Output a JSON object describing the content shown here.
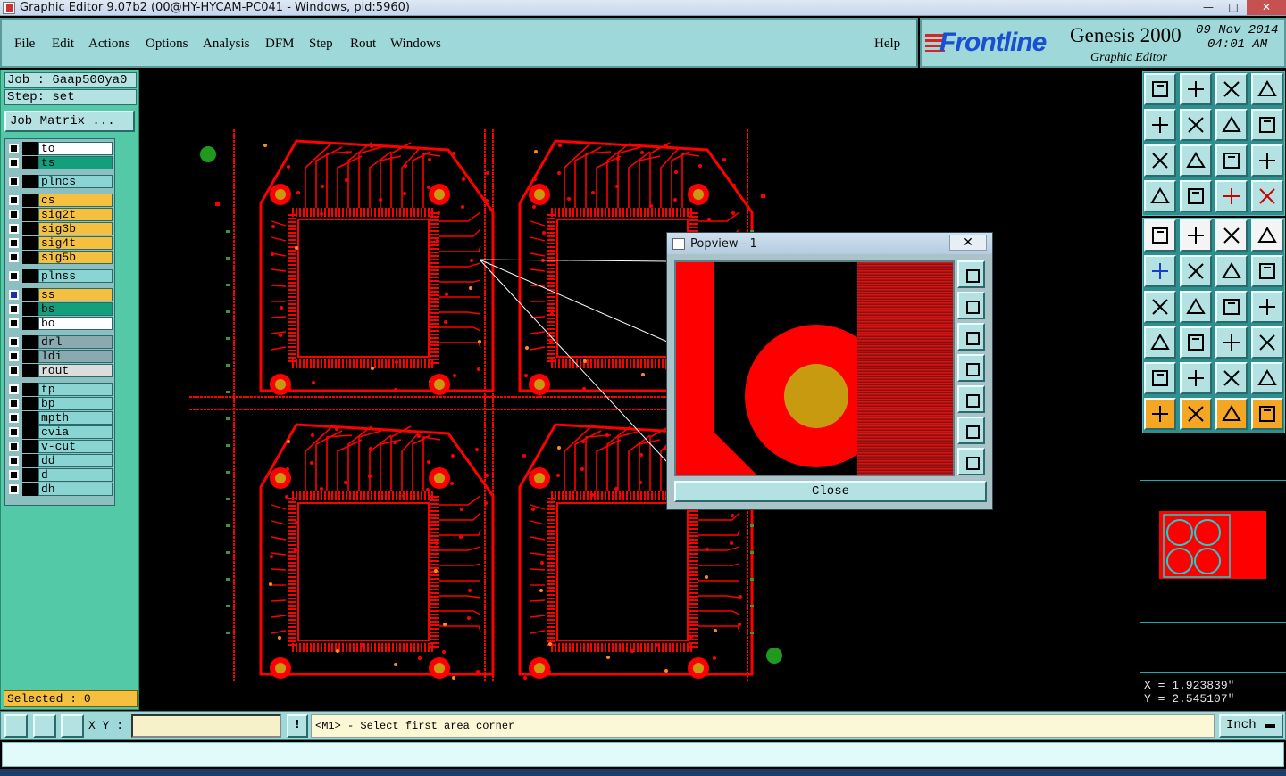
{
  "window": {
    "title": "Graphic Editor 9.07b2 (00@HY-HYCAM-PC041 - Windows, pid:5960)",
    "minimize": "—",
    "maximize": "□",
    "close": "✕"
  },
  "menu": {
    "items": [
      "File",
      "Edit",
      "Actions",
      "Options",
      "Analysis",
      "DFM",
      "Step",
      "Rout",
      "Windows"
    ],
    "help": "Help"
  },
  "brand": {
    "logo": "Frontline",
    "product": "Genesis 2000",
    "subtitle": "Graphic Editor",
    "date": "09 Nov 2014",
    "time": "04:01 AM"
  },
  "left": {
    "job": "Job : 6aap500ya0",
    "step": "Step: set",
    "job_matrix": "Job Matrix ...",
    "selected": "Selected : 0",
    "layers": [
      {
        "name": "to",
        "color": "#ffffff"
      },
      {
        "name": "ts",
        "color": "#12a07c"
      },
      {
        "name": "plncs",
        "color": "#8ad4d4"
      },
      {
        "name": "cs",
        "color": "#f5c040"
      },
      {
        "name": "sig2t",
        "color": "#f5c040"
      },
      {
        "name": "sig3b",
        "color": "#f5c040"
      },
      {
        "name": "sig4t",
        "color": "#f5c040"
      },
      {
        "name": "sig5b",
        "color": "#f5c040"
      },
      {
        "name": "plnss",
        "color": "#8ad4d4"
      },
      {
        "name": "ss",
        "color": "#f5c040",
        "active": true
      },
      {
        "name": "bs",
        "color": "#12a07c"
      },
      {
        "name": "bo",
        "color": "#ffffff"
      },
      {
        "name": "drl",
        "color": "#8aaab0",
        "active": true
      },
      {
        "name": "ldi",
        "color": "#8aaab0"
      },
      {
        "name": "rout",
        "color": "#dcdcdc"
      },
      {
        "name": "tp",
        "color": "#8ad4d4"
      },
      {
        "name": "bp",
        "color": "#8ad4d4"
      },
      {
        "name": "mpth",
        "color": "#8ad4d4"
      },
      {
        "name": "cvia",
        "color": "#8ad4d4"
      },
      {
        "name": "v-cut",
        "color": "#8ad4d4"
      },
      {
        "name": "dd",
        "color": "#8ad4d4"
      },
      {
        "name": "d",
        "color": "#8ad4d4"
      },
      {
        "name": "dh",
        "color": "#8ad4d4"
      }
    ]
  },
  "popview": {
    "title": "Popview - 1",
    "close_x": "✕",
    "close_label": "Close"
  },
  "status": {
    "xy_label": "X Y :",
    "xy_value": "",
    "excl": "!",
    "prompt": "<M1> - Select first area corner",
    "units": "Inch",
    "coord_x": "X = 1.923839\"",
    "coord_y": "Y = 2.545107\"",
    "message": ""
  },
  "colors": {
    "copper": "#ff0000",
    "pad_gold": "#c89a10",
    "fiducial": "#1f9a1f",
    "panel_bg": "#53c9a7",
    "menu_bg": "#9fd8d8"
  }
}
